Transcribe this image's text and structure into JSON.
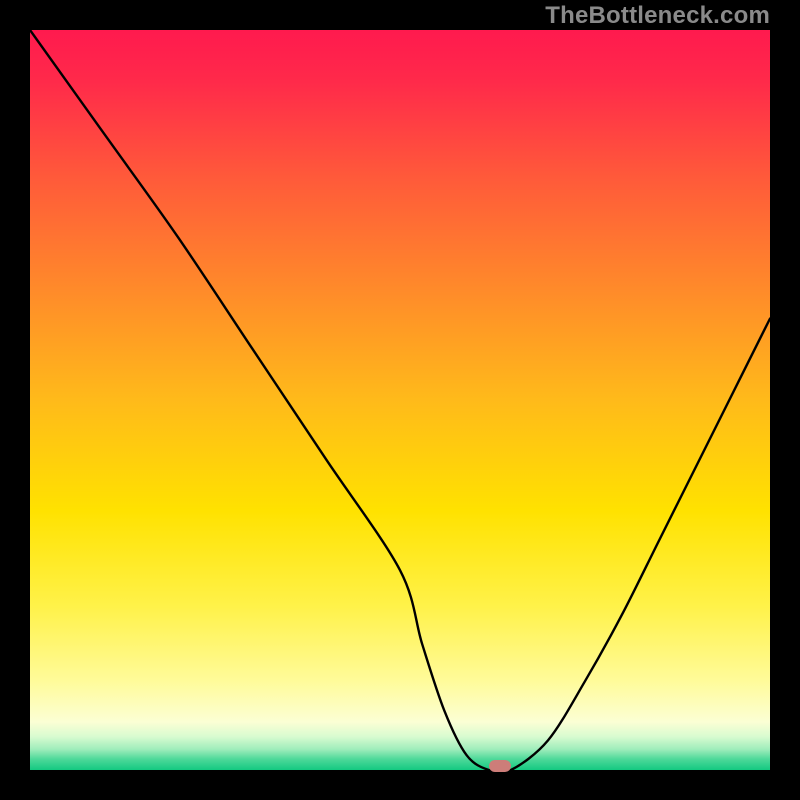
{
  "watermark": "TheBottleneck.com",
  "chart_data": {
    "type": "line",
    "title": "",
    "xlabel": "",
    "ylabel": "",
    "xlim": [
      0,
      100
    ],
    "ylim": [
      0,
      100
    ],
    "grid": false,
    "curve": {
      "name": "bottleneck-curve",
      "x": [
        0,
        10,
        20,
        30,
        40,
        50,
        53,
        56,
        59,
        62,
        65,
        70,
        75,
        80,
        85,
        90,
        95,
        100
      ],
      "y": [
        100,
        86,
        72,
        57,
        42,
        27,
        17,
        8,
        2,
        0,
        0,
        4,
        12,
        21,
        31,
        41,
        51,
        61
      ]
    },
    "marker": {
      "x": 63.5,
      "y": 0,
      "color": "#cd7d79"
    },
    "background_gradient_stops": [
      {
        "offset": 0.0,
        "color": "#ff1a4e"
      },
      {
        "offset": 0.07,
        "color": "#ff2a4a"
      },
      {
        "offset": 0.2,
        "color": "#ff5a3a"
      },
      {
        "offset": 0.35,
        "color": "#ff8a2a"
      },
      {
        "offset": 0.5,
        "color": "#ffba1a"
      },
      {
        "offset": 0.65,
        "color": "#ffe200"
      },
      {
        "offset": 0.78,
        "color": "#fff24a"
      },
      {
        "offset": 0.88,
        "color": "#fffb9a"
      },
      {
        "offset": 0.935,
        "color": "#fbffd4"
      },
      {
        "offset": 0.955,
        "color": "#d8fbd0"
      },
      {
        "offset": 0.972,
        "color": "#9fedbb"
      },
      {
        "offset": 0.985,
        "color": "#4fd99a"
      },
      {
        "offset": 1.0,
        "color": "#14c981"
      }
    ]
  }
}
